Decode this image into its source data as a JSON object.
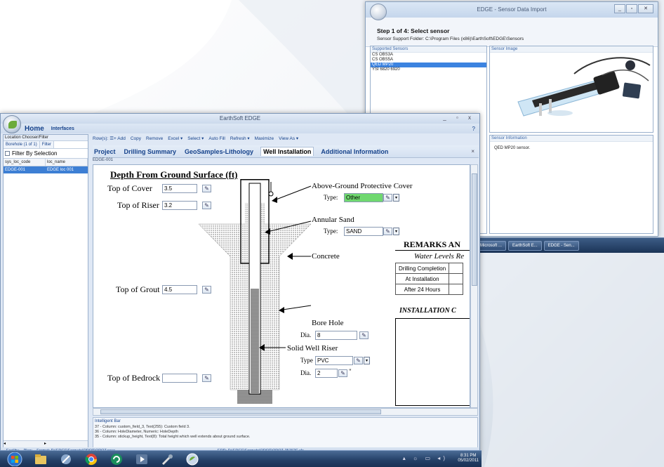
{
  "sensor_window": {
    "title": "EDGE - Sensor Data Import",
    "step_heading": "Step 1 of 4: Select sensor",
    "support_folder": "Sensor Support Folder:  C:\\Program Files (x86)\\EarthSoft\\EDGE\\Sensors",
    "list_header": "Supported Sensors",
    "sensors": [
      "CS OBS3A",
      "CS OBS5A",
      "QED MP20",
      "YSI 6820 6920"
    ],
    "selected_index": 2,
    "image_header": "Sensor Image",
    "info_header": "Sensor Information",
    "info_text": "QED MP20 sensor."
  },
  "taskbar_small": {
    "items": [
      "Microsoft ...",
      "EarthSoft E...",
      "EDGE - Sen..."
    ]
  },
  "main_window": {
    "title": "EarthSoft EDGE",
    "window_controls": "_ ▫ x",
    "ribbon_tabs": [
      "Home",
      "Interfaces"
    ],
    "help_icon": "?",
    "left_pane": {
      "header": "Location Chooser/Filter",
      "tabs": [
        "Borehole (1 of 1)",
        "Filter"
      ],
      "filter_label": "Filter By Selection",
      "columns": [
        "sys_loc_code",
        "loc_name"
      ],
      "rows": [
        [
          "EDGE-001",
          "EDGE loc 001"
        ]
      ]
    },
    "toolbar": [
      "Row(s): ☰+ Add",
      "Copy",
      "Remove",
      "Excel ▾",
      "Select ▾",
      "Auto Fill",
      "Refresh ▾",
      "Maximize",
      "View As ▾"
    ],
    "form_tabs": [
      "Project",
      "Drilling Summary",
      "GeoSamples-Lithology",
      "Well Installation",
      "Additional Information"
    ],
    "active_tab": 3,
    "form_subtitle": "EDGE-001",
    "close_form": "×",
    "diagram": {
      "title": "Depth From Ground Surface (ft)",
      "top_of_cover_label": "Top of Cover",
      "top_of_cover": "3.5",
      "top_of_riser_label": "Top of Riser",
      "top_of_riser": "3.2",
      "top_of_grout_label": "Top of Grout",
      "top_of_grout": "4.5",
      "top_of_bedrock_label": "Top of Bedrock",
      "top_of_bedrock": "",
      "cover_label": "Above-Ground Protective Cover",
      "cover_type_label": "Type:",
      "cover_type": "Other",
      "sand_label": "Annular Sand",
      "sand_type_label": "Type:",
      "sand_type": "SAND",
      "concrete_label": "Concrete",
      "bore_hole_label": "Bore Hole",
      "bore_dia_label": "Dia.",
      "bore_dia": "8",
      "riser_label": "Solid Well Riser",
      "riser_type_label": "Type",
      "riser_type": "PVC",
      "riser_dia_label": "Dia.",
      "riser_dia": "2",
      "riser_dia_unit": "\"",
      "remarks": "REMARKS AN",
      "water_levels": "Water Levels Re",
      "water_rows": [
        "Drilling Completion",
        "At Installation",
        "After 24 Hours"
      ],
      "installation": "INSTALLATION C"
    },
    "intelligent_bar": {
      "header": "Intelligent Bar",
      "lines": [
        "37 - Column: custom_field_3, Text(255): Custom field 3.",
        "36 - Column: HoleDiameter, Numeric: HoleDepth",
        "35 - Column: stickup_height, Text(8): Total height which well extends about ground surface."
      ]
    },
    "status": [
      "Facility:",
      "Plan:",
      "Format: D:\\EDGE\\Formats\\ODOT\\ODOT.xsse",
      "EDD: D:\\EDGE\\Formats\\ODOT\\ODOT-7576?C.xls"
    ]
  },
  "clock": {
    "time": "8:31 PM",
    "date": "05/02/2011"
  }
}
